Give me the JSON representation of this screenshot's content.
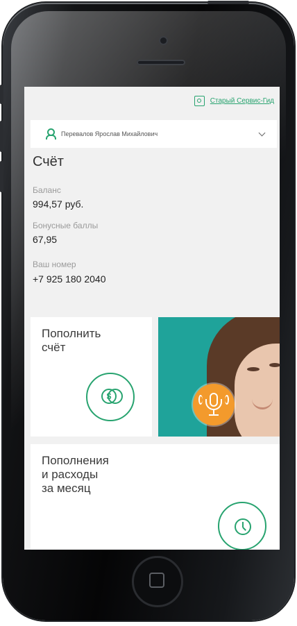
{
  "header": {
    "old_service_link": "Старый Сервис-Гид",
    "link_icon": "service-guide-icon"
  },
  "account_selector": {
    "name": "Перевалов Ярослав Михайлович",
    "user_icon": "user-icon",
    "chevron_icon": "chevron-down-icon"
  },
  "account": {
    "title": "Счёт",
    "balance_label": "Баланс",
    "balance_value": "994,57 руб.",
    "bonus_label": "Бонусные баллы",
    "bonus_value": "67,95",
    "number_label": "Ваш номер",
    "number_value": "+7 925 180 2040"
  },
  "tiles": {
    "top_up": {
      "title": "Пополнить\nсчёт",
      "icon": "coins-icon",
      "coin_symbol": "$"
    },
    "assistant": {
      "icon": "microphone-icon"
    },
    "history": {
      "title": "Пополнения\nи расходы\nза месяц",
      "icon": "clock-icon"
    }
  },
  "colors": {
    "accent": "#27a36f",
    "promo_bg": "#1fa39a",
    "mic_button": "#f39a2c"
  }
}
